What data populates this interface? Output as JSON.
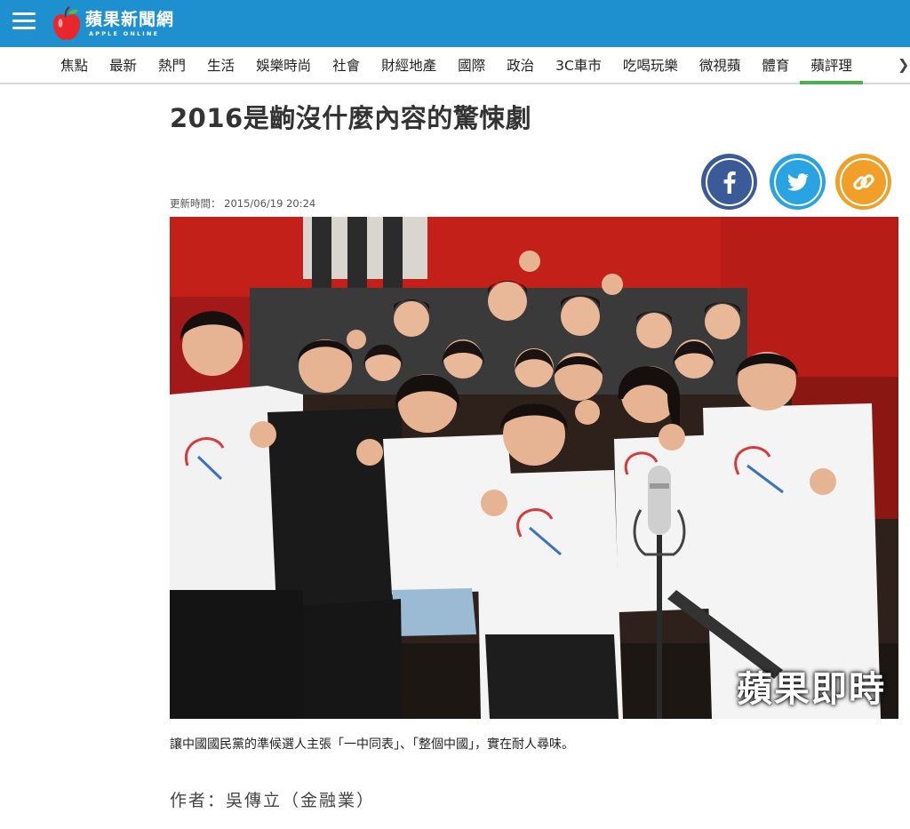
{
  "header": {
    "logo_main": "蘋果新聞網",
    "logo_sub": "APPLE ONLINE",
    "brand_color": "#1e8fcf"
  },
  "nav": {
    "items": [
      {
        "label": "焦點"
      },
      {
        "label": "最新"
      },
      {
        "label": "熱門"
      },
      {
        "label": "生活"
      },
      {
        "label": "娛樂時尚"
      },
      {
        "label": "社會"
      },
      {
        "label": "財經地產"
      },
      {
        "label": "國際"
      },
      {
        "label": "政治"
      },
      {
        "label": "3C車市"
      },
      {
        "label": "吃喝玩樂"
      },
      {
        "label": "微視蘋"
      },
      {
        "label": "體育"
      },
      {
        "label": "蘋評理",
        "active": true
      }
    ],
    "more_icon": "chevron-right-icon",
    "active_color": "#47b34c"
  },
  "article": {
    "title": "2016是齣沒什麼內容的驚悚劇",
    "updated_label": "更新時間：",
    "updated_time": "2015/06/19 20:24",
    "photo_watermark": "蘋果即時",
    "caption": "讓中國國民黨的準候選人主張「一中同表」、「整個中國」，實在耐人尋味。",
    "author": "作者：吳傳立（金融業）"
  },
  "share": {
    "facebook": {
      "icon": "facebook-icon",
      "color": "#3b5a98"
    },
    "twitter": {
      "icon": "twitter-icon",
      "color": "#2aa3e3"
    },
    "link": {
      "icon": "link-icon",
      "color": "#f0a028"
    }
  }
}
